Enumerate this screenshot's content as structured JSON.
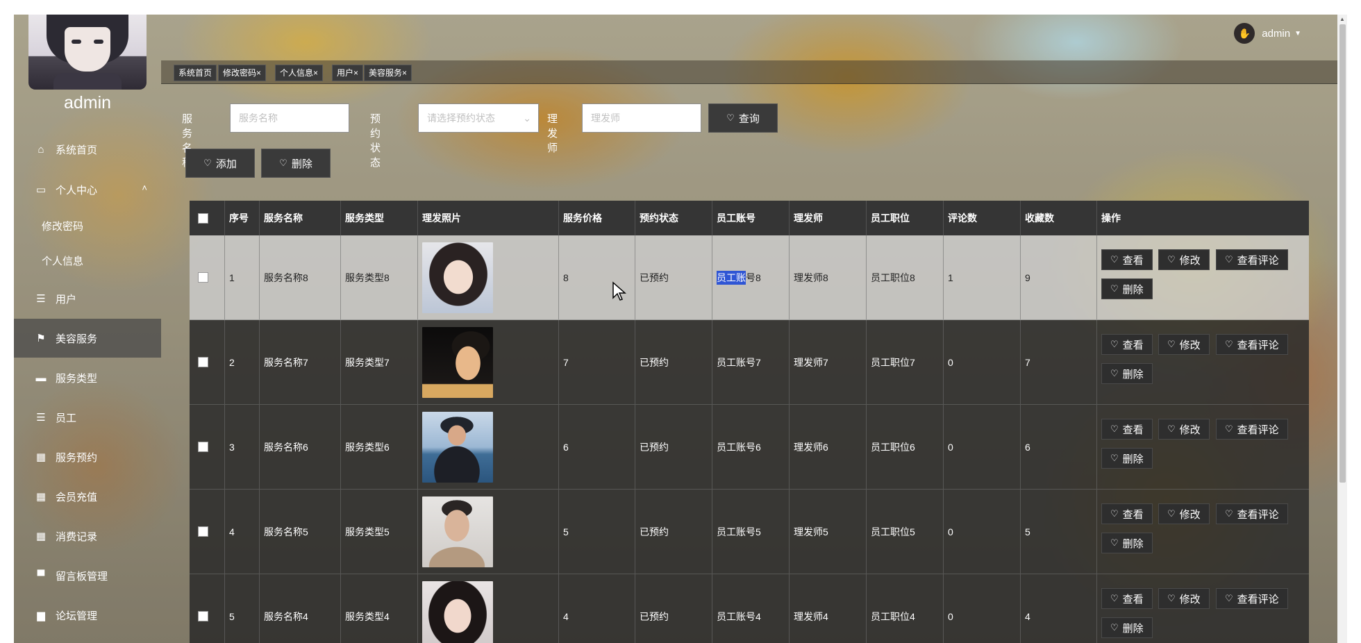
{
  "sidebar": {
    "admin_name": "admin",
    "items": [
      {
        "label": "系统首页",
        "icon": "home-icon"
      },
      {
        "label": "个人中心",
        "icon": "calendar-icon"
      },
      {
        "label": "修改密码",
        "icon": ""
      },
      {
        "label": "个人信息",
        "icon": ""
      },
      {
        "label": "用户",
        "icon": "list-icon"
      },
      {
        "label": "美容服务",
        "icon": "flag-icon"
      },
      {
        "label": "服务类型",
        "icon": "chat-icon"
      },
      {
        "label": "员工",
        "icon": "list-icon"
      },
      {
        "label": "服务预约",
        "icon": "grid-icon"
      },
      {
        "label": "会员充值",
        "icon": "grid-icon"
      },
      {
        "label": "消费记录",
        "icon": "grid-icon"
      },
      {
        "label": "留言板管理",
        "icon": "message-icon"
      },
      {
        "label": "论坛管理",
        "icon": "forum-icon"
      }
    ]
  },
  "header": {
    "user": "admin"
  },
  "tabs": [
    "系统首页",
    "修改密码×",
    "个人信息×",
    "用户×",
    "美容服务×"
  ],
  "search": {
    "name_label": "服务名称",
    "name_placeholder": "服务名称",
    "status_label": "预约状态",
    "status_placeholder": "请选择预约状态",
    "stylist_label": "理发师",
    "stylist_placeholder": "理发师",
    "query_button": "查询"
  },
  "actions": {
    "add": "添加",
    "delete": "删除"
  },
  "table": {
    "columns": [
      "序号",
      "服务名称",
      "服务类型",
      "理发照片",
      "服务价格",
      "预约状态",
      "员工账号",
      "理发师",
      "员工职位",
      "评论数",
      "收藏数",
      "操作"
    ],
    "rows": [
      {
        "no": "1",
        "name": "服务名称8",
        "type": "服务类型8",
        "price": "8",
        "status": "已预约",
        "account_a": "员工账",
        "account_b": "号8",
        "stylist": "理发师8",
        "position": "员工职位8",
        "comments": "1",
        "favorites": "9"
      },
      {
        "no": "2",
        "name": "服务名称7",
        "type": "服务类型7",
        "price": "7",
        "status": "已预约",
        "account_a": "员工账号7",
        "account_b": "",
        "stylist": "理发师7",
        "position": "员工职位7",
        "comments": "0",
        "favorites": "7"
      },
      {
        "no": "3",
        "name": "服务名称6",
        "type": "服务类型6",
        "price": "6",
        "status": "已预约",
        "account_a": "员工账号6",
        "account_b": "",
        "stylist": "理发师6",
        "position": "员工职位6",
        "comments": "0",
        "favorites": "6"
      },
      {
        "no": "4",
        "name": "服务名称5",
        "type": "服务类型5",
        "price": "5",
        "status": "已预约",
        "account_a": "员工账号5",
        "account_b": "",
        "stylist": "理发师5",
        "position": "员工职位5",
        "comments": "0",
        "favorites": "5"
      },
      {
        "no": "5",
        "name": "服务名称4",
        "type": "服务类型4",
        "price": "4",
        "status": "已预约",
        "account_a": "员工账号4",
        "account_b": "",
        "stylist": "理发师4",
        "position": "员工职位4",
        "comments": "0",
        "favorites": "4"
      }
    ],
    "ops": {
      "view": "查看",
      "edit": "修改",
      "view_comments": "查看评论",
      "delete": "删除"
    }
  },
  "colors": {
    "row_dark": "#282828",
    "row_highlight": "#cdcdcd",
    "selection": "#2f55d4",
    "button": "#3a3a3a"
  }
}
